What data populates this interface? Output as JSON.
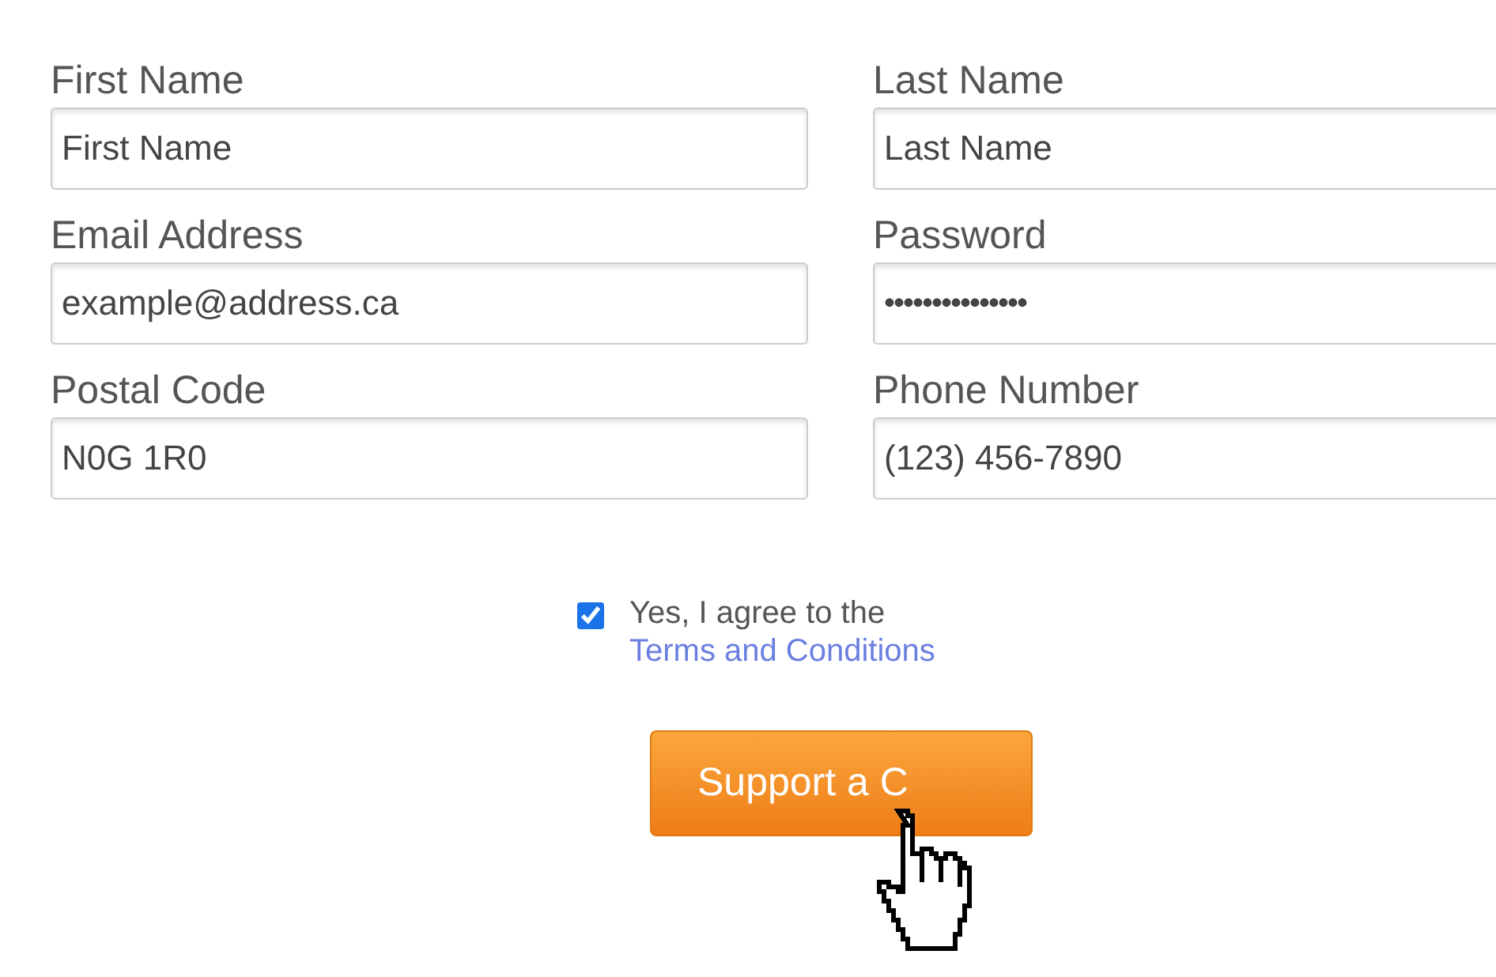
{
  "fields": [
    {
      "label": "First Name",
      "value": "First Name",
      "kind": "text"
    },
    {
      "label": "Last Name",
      "value": "Last Name",
      "kind": "text"
    },
    {
      "label": "Email Address",
      "value": "example@address.ca",
      "kind": "text"
    },
    {
      "label": "Password",
      "value": "•••••••••••••••",
      "kind": "password"
    },
    {
      "label": "Postal Code",
      "value": "N0G 1R0",
      "kind": "text"
    },
    {
      "label": "Phone Number",
      "value": "(123) 456-7890",
      "kind": "text"
    }
  ],
  "consent": {
    "text": "Yes, I agree to the",
    "link": "Terms and Conditions",
    "checked": true
  },
  "submit": {
    "label": "Support a C"
  }
}
